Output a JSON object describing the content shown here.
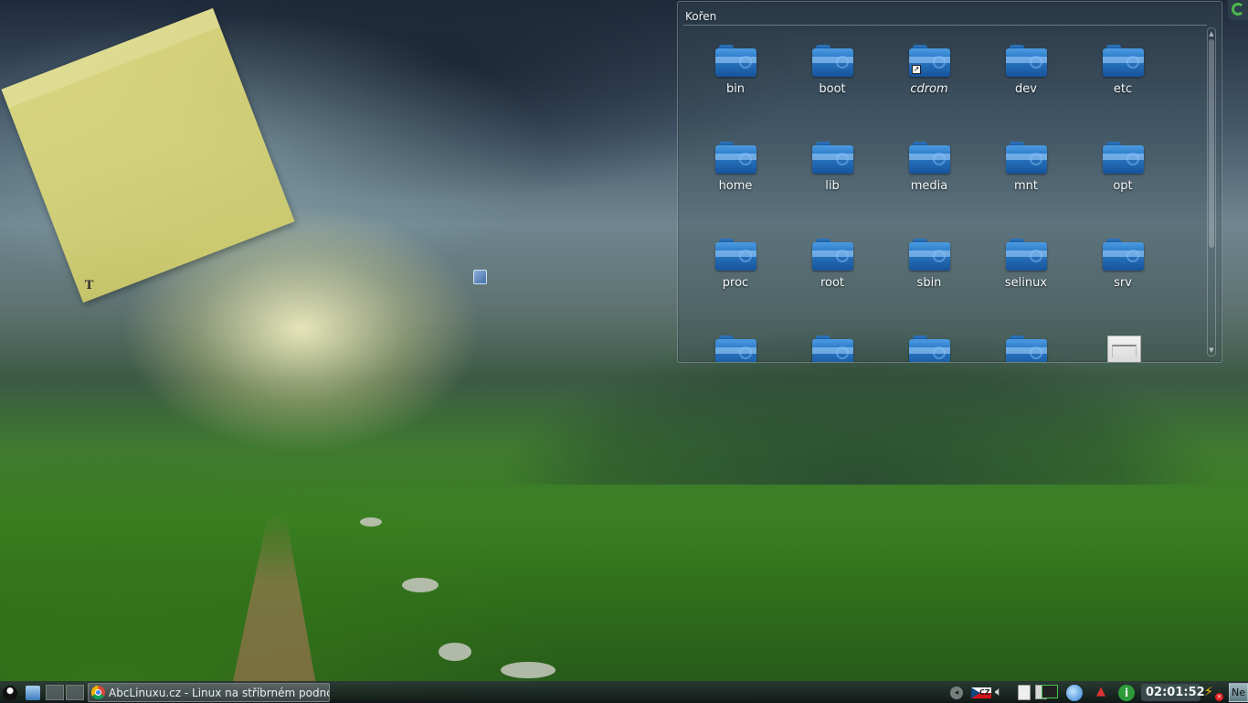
{
  "folderview": {
    "title": "Kořen",
    "items": [
      {
        "label": "bin",
        "type": "folder"
      },
      {
        "label": "boot",
        "type": "folder"
      },
      {
        "label": "cdrom",
        "type": "folder-link"
      },
      {
        "label": "dev",
        "type": "folder"
      },
      {
        "label": "etc",
        "type": "folder"
      },
      {
        "label": "home",
        "type": "folder"
      },
      {
        "label": "lib",
        "type": "folder"
      },
      {
        "label": "media",
        "type": "folder"
      },
      {
        "label": "mnt",
        "type": "folder"
      },
      {
        "label": "opt",
        "type": "folder"
      },
      {
        "label": "proc",
        "type": "folder"
      },
      {
        "label": "root",
        "type": "folder"
      },
      {
        "label": "sbin",
        "type": "folder"
      },
      {
        "label": "selinux",
        "type": "folder"
      },
      {
        "label": "srv",
        "type": "folder"
      },
      {
        "label": "",
        "type": "folder"
      },
      {
        "label": "",
        "type": "folder"
      },
      {
        "label": "",
        "type": "folder"
      },
      {
        "label": "",
        "type": "folder"
      },
      {
        "label": "",
        "type": "archive"
      }
    ]
  },
  "taskbar": {
    "task_label": "AbcLinuxu.cz - Linux na stříbrném podnose",
    "keyboard_layout": "CZ",
    "clock": "02:01:52",
    "show_desktop_label": "Ne"
  },
  "icons": {
    "launcher": "tux-icon",
    "files": "file-manager-icon",
    "browser": "chrome-icon",
    "volume": "speaker-icon",
    "clipboard": "clipboard-icon",
    "power": "battery-icon"
  },
  "colors": {
    "folder_blue": "#2b79c6",
    "note_yellow": "#e8e282",
    "accent_green": "#4db84a"
  }
}
